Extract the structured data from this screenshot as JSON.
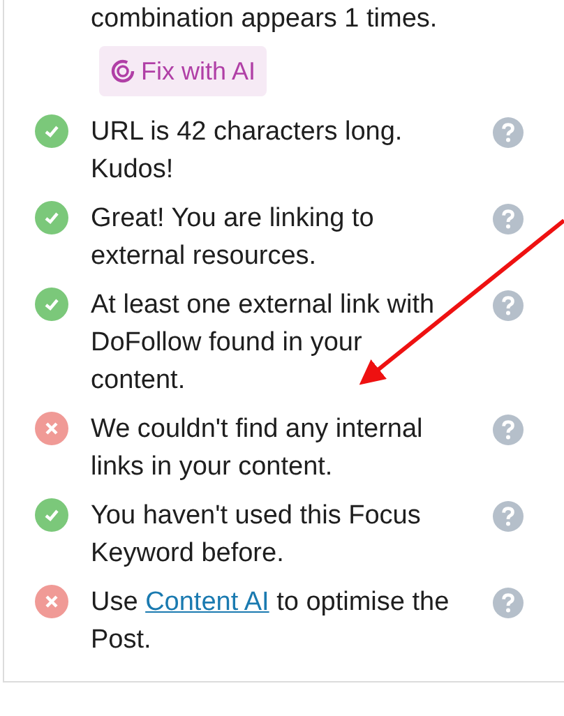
{
  "top_item": {
    "text": "combination appears 1 times.",
    "button": "Fix with AI"
  },
  "checks": [
    {
      "passed": true,
      "text": "URL is 42 characters long. Kudos!"
    },
    {
      "passed": true,
      "text": "Great! You are linking to external resources."
    },
    {
      "passed": true,
      "text": "At least one external link with DoFollow found in your content."
    },
    {
      "passed": false,
      "text": "We couldn't find any internal links in your content."
    },
    {
      "passed": true,
      "text": "You haven't used this Focus Keyword before."
    },
    {
      "passed": false,
      "text": "Use ",
      "link": "Content AI",
      "text_after": " to optimise the Post."
    }
  ]
}
